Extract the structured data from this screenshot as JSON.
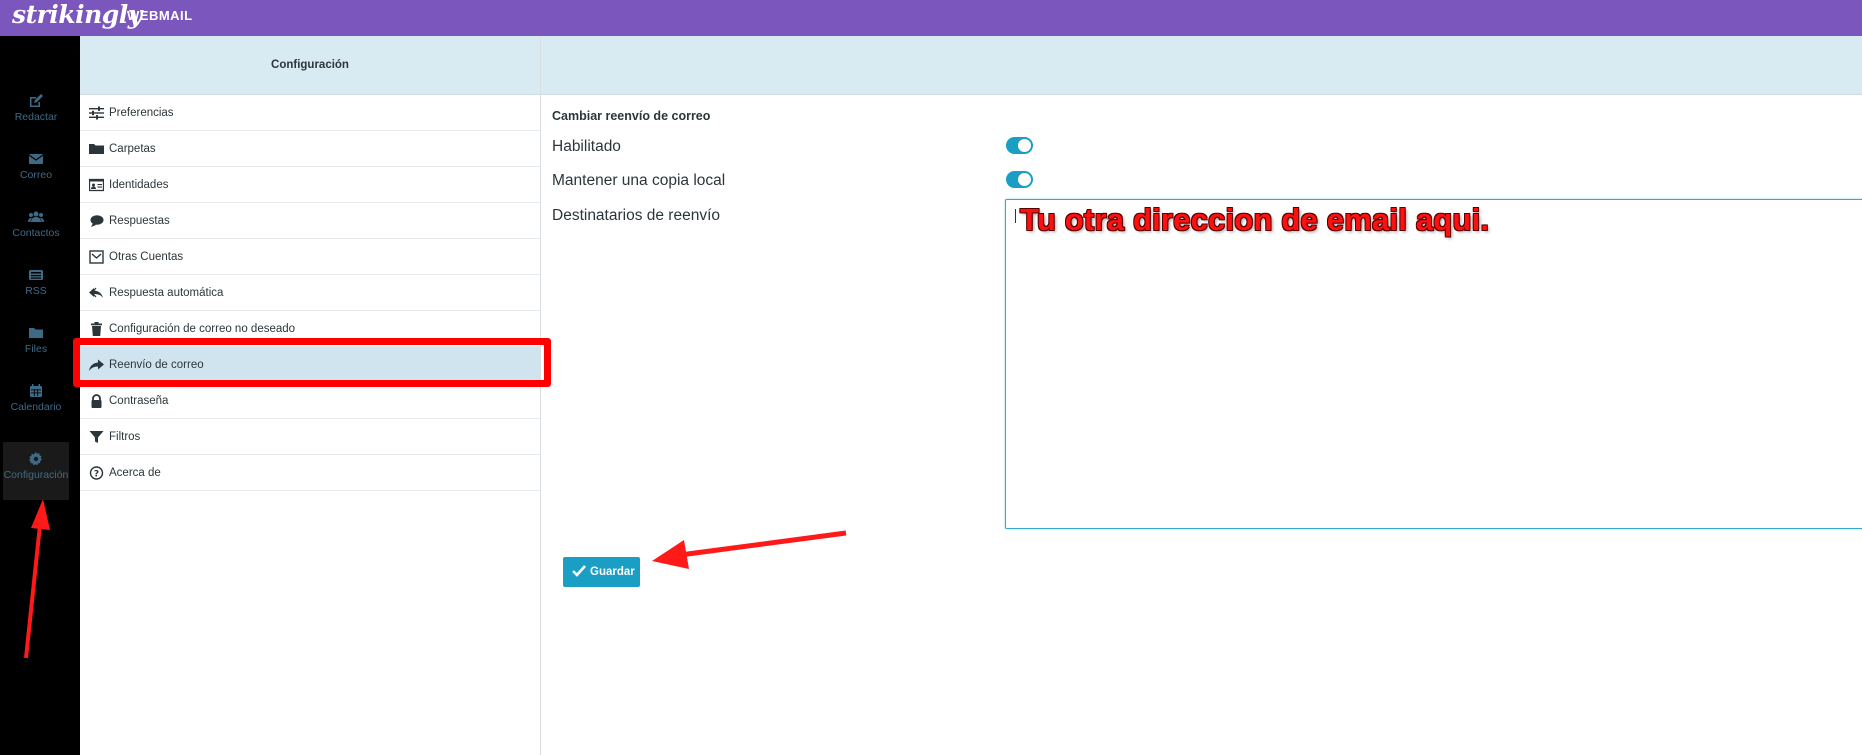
{
  "brand": {
    "logo": "strikingly",
    "product": "WEBMAIL",
    "colors": {
      "topbar": "#7b57bd",
      "accent": "#1a9ec4",
      "annotation": "#ff0000"
    }
  },
  "taskmenu": {
    "items": [
      {
        "label": "Redactar",
        "icon": "compose-icon"
      },
      {
        "label": "Correo",
        "icon": "mail-icon"
      },
      {
        "label": "Contactos",
        "icon": "contacts-icon"
      },
      {
        "label": "RSS",
        "icon": "rss-icon"
      },
      {
        "label": "Files",
        "icon": "folder-icon"
      },
      {
        "label": "Calendario",
        "icon": "calendar-icon"
      },
      {
        "label": "Configuración",
        "icon": "gear-icon",
        "selected": true
      }
    ]
  },
  "settings_nav": {
    "header": "Configuración",
    "items": [
      {
        "label": "Preferencias",
        "icon": "sliders-icon"
      },
      {
        "label": "Carpetas",
        "icon": "folder-icon"
      },
      {
        "label": "Identidades",
        "icon": "id-card-icon"
      },
      {
        "label": "Respuestas",
        "icon": "speech-bubble-icon"
      },
      {
        "label": "Otras Cuentas",
        "icon": "inbox-icon"
      },
      {
        "label": "Respuesta automática",
        "icon": "reply-all-icon"
      },
      {
        "label": "Configuración de correo no deseado",
        "icon": "trash-icon"
      },
      {
        "label": "Reenvío de correo",
        "icon": "forward-icon",
        "selected": true
      },
      {
        "label": "Contraseña",
        "icon": "lock-icon"
      },
      {
        "label": "Filtros",
        "icon": "filter-icon"
      },
      {
        "label": "Acerca de",
        "icon": "question-circle-icon"
      }
    ]
  },
  "form": {
    "title": "Cambiar reenvío de correo",
    "enabled_label": "Habilitado",
    "enabled": true,
    "keep_copy_label": "Mantener una copia local",
    "keep_copy": true,
    "recipients_label": "Destinatarios de reenvío",
    "recipients_value": "",
    "save_label": "Guardar"
  },
  "annotations": {
    "textarea_note": "Tu otra direccion de email aqui."
  }
}
